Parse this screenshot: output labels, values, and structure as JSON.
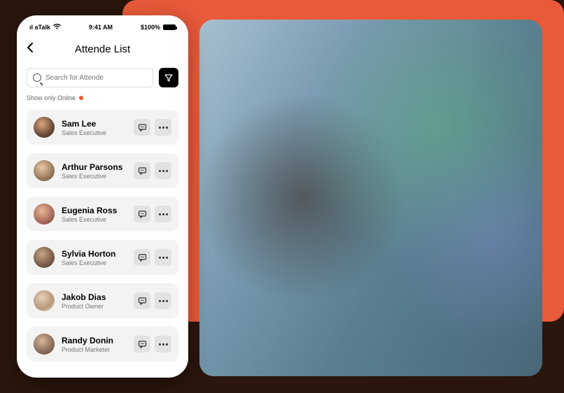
{
  "status": {
    "carrier": "ıl aTalk",
    "wifi": "wifi",
    "time": "9:41 AM",
    "battery": "$100%"
  },
  "header": {
    "title": "Attende List"
  },
  "search": {
    "placeholder": "Search for Attende"
  },
  "filter": {
    "show_online_label": "Show only Online"
  },
  "attendees": [
    {
      "name": "Sam Lee",
      "role": "Sales Executive"
    },
    {
      "name": "Arthur Parsons",
      "role": "Sales Executive"
    },
    {
      "name": "Eugenia Ross",
      "role": "Sales Executive"
    },
    {
      "name": "Sylvia Horton",
      "role": "Sales Executive"
    },
    {
      "name": "Jakob Dias",
      "role": "Product Owner"
    },
    {
      "name": "Randy Donin",
      "role": "Product Marketer"
    }
  ]
}
